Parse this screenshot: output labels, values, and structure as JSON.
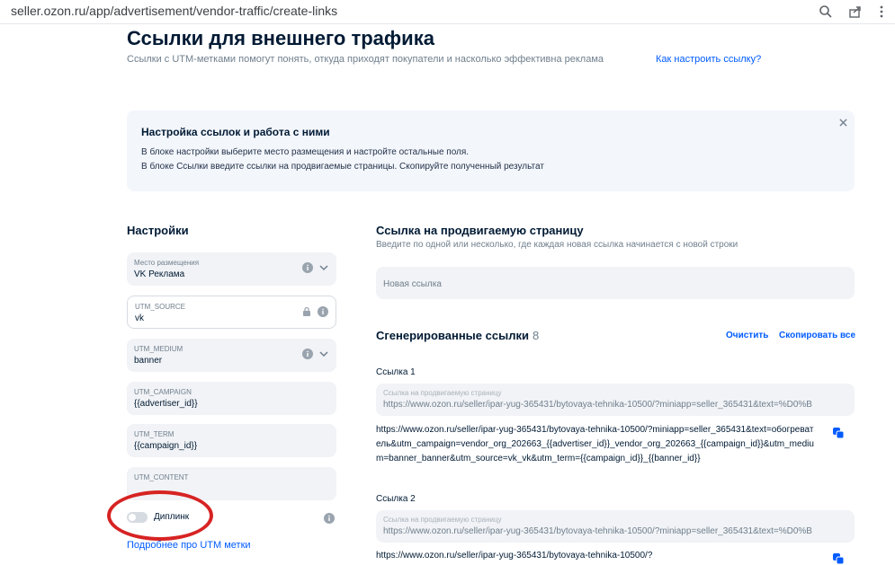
{
  "browser": {
    "url": "seller.ozon.ru/app/advertisement/vendor-traffic/create-links",
    "icons": [
      "zoom-icon",
      "share-icon",
      "star-icon",
      "more-icon"
    ]
  },
  "page": {
    "title": "Ссылки для внешнего трафика",
    "subtitle": "Ссылки с UTM-метками помогут понять, откуда приходят покупатели и насколько эффективна реклама",
    "help_link": "Как настроить ссылку?"
  },
  "notice": {
    "title": "Настройка ссылок и работа с ними",
    "line1": "В блоке настройки выберите место размещения и настройте остальные поля.",
    "line2": "В блоке Ссылки введите ссылки на продвигаемые страницы. Скопируйте полученный результат"
  },
  "settings": {
    "title": "Настройки",
    "placement": {
      "label": "Место размещения",
      "value": "VK Реклама"
    },
    "utm_source": {
      "label": "UTM_SOURCE",
      "value": "vk"
    },
    "utm_medium": {
      "label": "UTM_MEDIUM",
      "value": "banner"
    },
    "utm_campaign": {
      "label": "UTM_CAMPAIGN",
      "value": "{{advertiser_id}}"
    },
    "utm_term": {
      "label": "UTM_TERM",
      "value": "{{campaign_id}}"
    },
    "utm_content": {
      "label": "UTM_CONTENT",
      "value": ""
    },
    "deeplink_label": "Диплинк",
    "deeplink_enabled": false,
    "utm_help_link": "Подробнее про UTM метки"
  },
  "promoted": {
    "title": "Ссылка на продвигаемую страницу",
    "subtitle": "Введите по одной или несколько, где каждая новая ссылка начинается с новой строки",
    "placeholder": "Новая ссылка"
  },
  "generated": {
    "title": "Сгенерированные ссылки",
    "count": "8",
    "clear_label": "Очистить",
    "copy_all_label": "Скопировать все",
    "links": [
      {
        "label": "Ссылка 1",
        "field_label": "Ссылка на продвигаемую страницу",
        "source": "https://www.ozon.ru/seller/ipar-yug-365431/bytovaya-tehnika-10500/?miniapp=seller_365431&text=%D0%B",
        "result": "https://www.ozon.ru/seller/ipar-yug-365431/bytovaya-tehnika-10500/?miniapp=seller_365431&text=обогреватель&utm_campaign=vendor_org_202663_{{advertiser_id}}_vendor_org_202663_{{campaign_id}}&utm_medium=banner_banner&utm_source=vk_vk&utm_term={{campaign_id}}_{{banner_id}}"
      },
      {
        "label": "Ссылка 2",
        "field_label": "Ссылка на продвигаемую страницу",
        "source": "https://www.ozon.ru/seller/ipar-yug-365431/bytovaya-tehnika-10500/?miniapp=seller_365431&text=%D0%B",
        "result": "https://www.ozon.ru/seller/ipar-yug-365431/bytovaya-tehnika-10500/?"
      }
    ]
  },
  "colors": {
    "accent": "#005bff",
    "annotation": "#d72323",
    "field_bg": "#f1f3f6"
  }
}
